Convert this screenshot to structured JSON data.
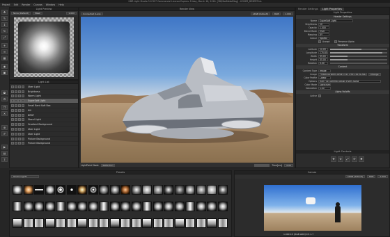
{
  "window_title": "HDR Light Studio 3.0 RC7 Commercial License Expires: Friday, March 18, 2016. [3D/ModMetalMag] - HOVER_DESERT.hls",
  "menu": [
    "Project",
    "Edit",
    "Render",
    "Canvas",
    "Window",
    "Help"
  ],
  "light_preview": {
    "title": "Light Preview",
    "dropdown1": "None (Default)",
    "dropdown2": "Mask",
    "value": "1.000"
  },
  "light_list": {
    "title": "Light List",
    "items": [
      {
        "label": "Uber Light",
        "selected": false
      },
      {
        "label": "Brightness",
        "selected": false
      },
      {
        "label": "Warm Light",
        "selected": false
      },
      {
        "label": "SuperSoft Light",
        "selected": true
      },
      {
        "label": "Small Bent Soft Box",
        "selected": false
      },
      {
        "label": "Kill",
        "selected": false
      },
      {
        "label": "BRDF",
        "selected": false
      },
      {
        "label": "Stand Light",
        "selected": false
      },
      {
        "label": "Gradient Background",
        "selected": false
      },
      {
        "label": "Uber Light",
        "selected": false
      },
      {
        "label": "Uber Light",
        "selected": false
      },
      {
        "label": "Picture Background",
        "selected": false
      },
      {
        "label": "Picture Background",
        "selected": false
      }
    ]
  },
  "render_view": {
    "title": "Render View",
    "top_dropdown": "Connected (Live)",
    "right_dropdown": "sRGB (default)",
    "right_dropdown2": "RGB",
    "right_value": "1.000",
    "bottom_left": "LightPaint Mode",
    "bottom_mode": "Reflection",
    "bottom_time_label": "Time[ms]",
    "bottom_time": "0.00"
  },
  "presets": {
    "title": "Presets",
    "category": "Studio Lights"
  },
  "canvas": {
    "title": "Canvas",
    "dd1": "sRGB (default)",
    "dd2": "RGB",
    "value": "1.000",
    "readout": "1.000  0.5 [RGB ADD] 0.5 1.7"
  },
  "light_properties": {
    "tabs": [
      "Render Settings",
      "Light Properties"
    ],
    "title": "Light Properties",
    "sections": {
      "header": "Header Settings",
      "transform": "Transform",
      "content": "Content",
      "alpha": "Alpha Falloffs"
    },
    "header_rows": [
      {
        "label": "Name",
        "value": "SuperSoft Light"
      },
      {
        "label": "Brightness",
        "value": "10"
      },
      {
        "label": "Opacity",
        "value": "1.000"
      },
      {
        "label": "Blend Mode",
        "value": "Over"
      },
      {
        "label": "Mapping",
        "value": "XY"
      },
      {
        "label": "Colour",
        "value": "Spatial"
      }
    ],
    "checks": {
      "accept": "Accept",
      "preserve": "Preserve Alpha"
    },
    "transform_rows": [
      {
        "label": "Latitude",
        "value": "12.09",
        "fill": 0.55
      },
      {
        "label": "Longitude",
        "value": "175.65",
        "fill": 0.92
      },
      {
        "label": "Width",
        "value": "35.00",
        "fill": 0.3
      },
      {
        "label": "Height",
        "value": "35.00",
        "fill": 0.3
      },
      {
        "label": "Rotation",
        "value": "0.00",
        "fill": 0.0
      }
    ],
    "content_rows": [
      {
        "label": "Content Type",
        "value": "Image"
      },
      {
        "label": "Image",
        "value": "Presets\\BrokenLights\\7045-0965-4616-A6D8-FF7B1C9E11...",
        "button": "Change"
      },
      {
        "label": "Color Profile",
        "value": "Linear"
      },
      {
        "label": "Options",
        "value": "Half   Flip   Gamma Adjust   Invert Alpha"
      },
      {
        "label": "Color Mode",
        "value": "Spectrum"
      },
      {
        "label": "Saturation",
        "value": "1.00"
      }
    ],
    "alpha_row": {
      "label": "Active",
      "value": ""
    },
    "light_controls": "Light Controls"
  }
}
